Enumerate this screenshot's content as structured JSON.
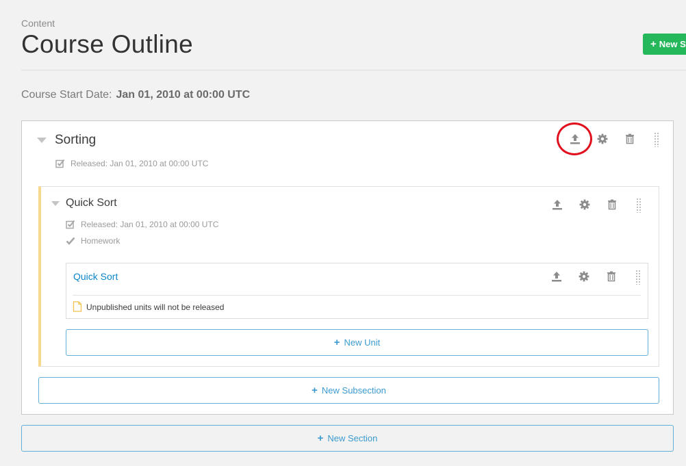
{
  "header": {
    "eyebrow": "Content",
    "title": "Course Outline",
    "new_section_label": "New Se"
  },
  "course": {
    "start_date_label": "Course Start Date:",
    "start_date_value": "Jan 01, 2010 at 00:00 UTC"
  },
  "section": {
    "title": "Sorting",
    "release_status": "Released: Jan 01, 2010 at 00:00 UTC",
    "subsection": {
      "title": "Quick Sort",
      "release_status": "Released: Jan 01, 2010 at 00:00 UTC",
      "grading_type": "Homework",
      "unit": {
        "title": "Quick Sort",
        "note": "Unpublished units will not be released"
      },
      "new_unit_label": "New Unit"
    },
    "new_subsection_label": "New Subsection"
  },
  "new_section_bottom_label": "New Section",
  "icons": {
    "publish": "upload-icon",
    "settings": "gear-icon",
    "delete": "trash-icon",
    "drag": "drag-handle-icon",
    "released": "checkbox-checked-icon",
    "graded": "checkmark-icon",
    "unit_note": "document-icon"
  },
  "colors": {
    "accent_green": "#25b85a",
    "link_blue": "#0a86c8",
    "add_button_blue": "#3b9bd0",
    "subsection_stripe": "#f6d98e",
    "annotation_red": "#e0101d"
  }
}
